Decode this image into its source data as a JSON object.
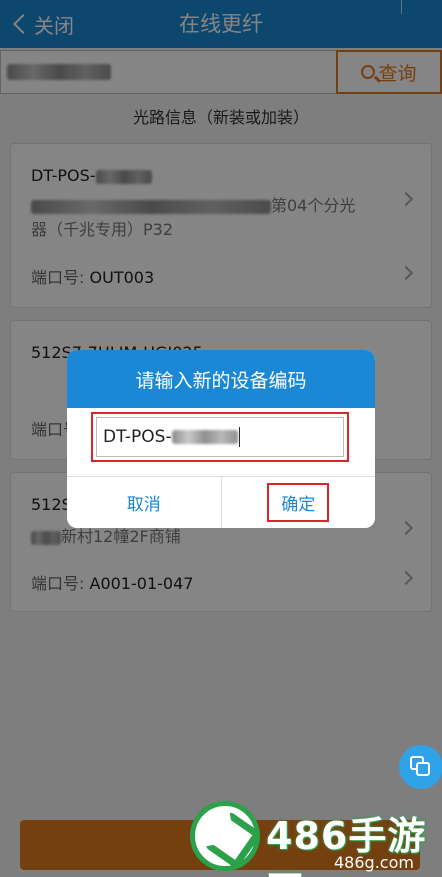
{
  "header": {
    "back_label": "关闭",
    "title": "在线更纤"
  },
  "search": {
    "button_label": "查询"
  },
  "section_title": "光路信息（新装或加装）",
  "cards": [
    {
      "code": "DT-POS-",
      "desc_suffix": "第04个分光",
      "desc_line2": "器（千兆专用）P32",
      "port_label": "端口号:",
      "port_value": "OUT003"
    },
    {
      "code": "512S7-7HLIM-HGJ025",
      "port_label": "端口号:",
      "port_value": ""
    },
    {
      "code": "512S",
      "desc_suffix": "新村12幢2F商铺",
      "port_label": "端口号:",
      "port_value": "A001-01-047"
    }
  ],
  "dialog": {
    "title": "请输入新的设备编码",
    "input_value": "DT-POS-",
    "cancel_label": "取消",
    "confirm_label": "确定"
  },
  "watermark": {
    "main": "486手游网",
    "sub": "486g.com"
  },
  "colors": {
    "header_blue": "#1a88d4",
    "accent_orange": "#e07b1f",
    "highlight_red": "#d9262c",
    "watermark_green": "#2aa14a"
  }
}
